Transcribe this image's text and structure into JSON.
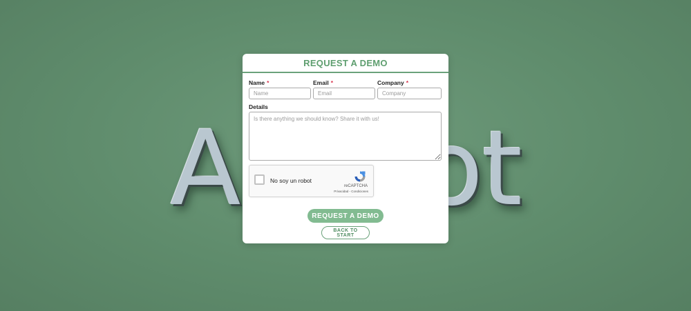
{
  "background": {
    "logo_text": "Acobot"
  },
  "modal": {
    "title": "REQUEST A DEMO",
    "fields": {
      "name": {
        "label": "Name",
        "required_mark": "*",
        "placeholder": "Name"
      },
      "email": {
        "label": "Email",
        "required_mark": "*",
        "placeholder": "Email"
      },
      "company": {
        "label": "Company",
        "required_mark": "*",
        "placeholder": "Company"
      },
      "details": {
        "label": "Details",
        "placeholder": "Is there anything we should know? Share it with us!"
      }
    },
    "captcha": {
      "label": "No soy un robot",
      "brand": "reCAPTCHA",
      "links": "Privacidad - Condiciones",
      "checked": false
    },
    "submit_label": "REQUEST A DEMO",
    "back_label": "BACK TO START"
  },
  "colors": {
    "accent": "#5e9e6f",
    "button": "#82bb91",
    "required": "#d9364f",
    "background": "#5f8c6c"
  }
}
